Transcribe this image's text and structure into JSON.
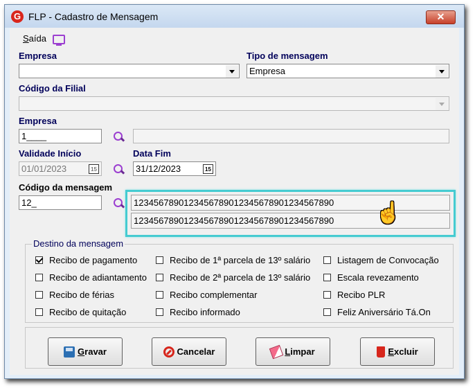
{
  "window": {
    "title": "FLP - Cadastro de Mensagem",
    "app_icon": "G",
    "close_label": "✕"
  },
  "menu": {
    "exit_label": "Saída"
  },
  "form": {
    "empresa_label": "Empresa",
    "empresa_combo_value": "",
    "tipo_label": "Tipo de mensagem",
    "tipo_value": "Empresa",
    "filial_label": "Código da Filial",
    "filial_value": "",
    "empresa2_label": "Empresa",
    "empresa2_value": "1____",
    "empresa2_name": "",
    "validade_label": "Validade Início",
    "validade_value": "01/01/2023",
    "data_fim_label": "Data Fim",
    "data_fim_value": "31/12/2023",
    "calendar_glyph": "15",
    "codigo_label": "Código da mensagem",
    "codigo_value": "12_",
    "message_line1": "1234567890123456789012345678901234567890",
    "message_line2": "1234567890123456789012345678901234567890"
  },
  "destino": {
    "title": "Destino da mensagem",
    "col1": [
      {
        "label": "Recibo de pagamento",
        "checked": true
      },
      {
        "label": "Recibo de adiantamento",
        "checked": false
      },
      {
        "label": "Recibo de férias",
        "checked": false
      },
      {
        "label": "Recibo de quitação",
        "checked": false
      }
    ],
    "col2": [
      {
        "label": "Recibo de 1ª parcela de 13º salário",
        "checked": false
      },
      {
        "label": "Recibo de 2ª parcela de 13º salário",
        "checked": false
      },
      {
        "label": "Recibo complementar",
        "checked": false
      },
      {
        "label": "Recibo informado",
        "checked": false
      }
    ],
    "col3": [
      {
        "label": "Listagem de Convocação",
        "checked": false
      },
      {
        "label": "Escala revezamento",
        "checked": false
      },
      {
        "label": "Recibo PLR",
        "checked": false
      },
      {
        "label": "Feliz Aniversário Tá.On",
        "checked": false
      }
    ]
  },
  "buttons": {
    "save": "Gravar",
    "cancel": "Cancelar",
    "clear": "Limpar",
    "delete": "Excluir"
  },
  "colors": {
    "label_blue": "#00005a",
    "highlight": "#45cbd1",
    "accent_purple": "#9b3ed0",
    "close_red": "#c7402a"
  }
}
